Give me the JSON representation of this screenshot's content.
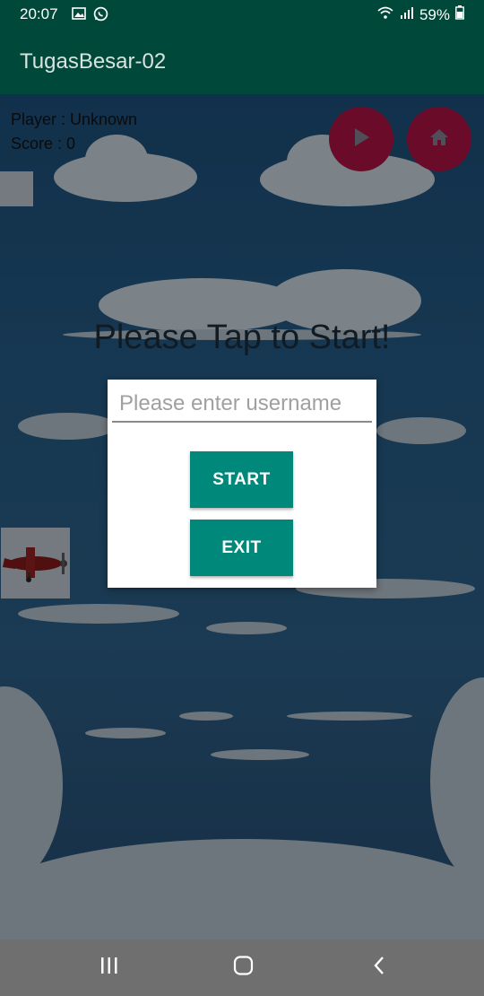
{
  "status_bar": {
    "time": "20:07",
    "battery_percent": "59%",
    "icons": [
      "image-icon",
      "whatsapp-icon",
      "wifi-icon",
      "signal-icon",
      "battery-icon"
    ]
  },
  "app_bar": {
    "title": "TugasBesar-02"
  },
  "hud": {
    "player": "Player : Unknown",
    "score": "Score :  0"
  },
  "game": {
    "tap_to_start": "Please Tap to Start!",
    "buttons": [
      "play-icon",
      "home-icon"
    ]
  },
  "dialog": {
    "username_placeholder": "Please enter username",
    "username_value": "",
    "start_label": "START",
    "exit_label": "EXIT"
  },
  "colors": {
    "app_bar": "#00483a",
    "accent_button": "#00897b",
    "round_button": "#a3123f",
    "nav_bar": "#6f6f6f"
  },
  "nav_bar": {
    "buttons": [
      "recents-icon",
      "home-nav-icon",
      "back-icon"
    ]
  }
}
